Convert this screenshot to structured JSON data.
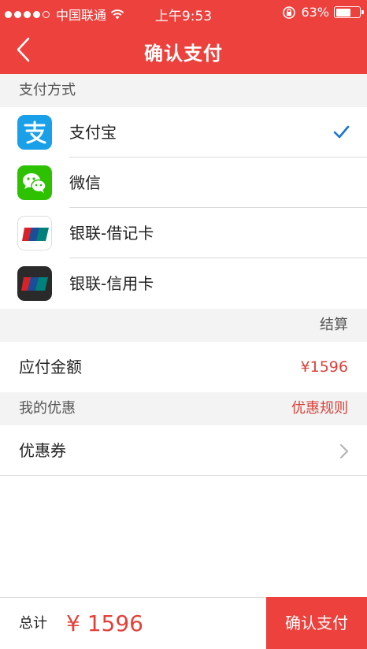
{
  "status_bar": {
    "carrier": "中国联通",
    "time": "上午9:53",
    "battery": "63%",
    "battery_level": 0.63
  },
  "nav": {
    "title": "确认支付"
  },
  "payment": {
    "section_title": "支付方式",
    "methods": [
      {
        "label": "支付宝",
        "icon": "alipay-icon",
        "selected": true
      },
      {
        "label": "微信",
        "icon": "wechat-icon",
        "selected": false
      },
      {
        "label": "银联-借记卡",
        "icon": "unionpay-debit-icon",
        "selected": false
      },
      {
        "label": "银联-信用卡",
        "icon": "unionpay-credit-icon",
        "selected": false
      }
    ]
  },
  "settlement": {
    "section_title": "结算",
    "amount_label": "应付金额",
    "amount_value": "¥1596"
  },
  "discount": {
    "section_title": "我的优惠",
    "rules_link": "优惠规则",
    "coupon_label": "优惠券"
  },
  "footer": {
    "total_label": "总计",
    "total_value": "¥ 1596",
    "confirm_label": "确认支付"
  },
  "colors": {
    "brand_red": "#ec413d",
    "price_red": "#e3403a",
    "check_blue": "#1a73d9",
    "alipay_blue": "#1aa0e8",
    "wechat_green": "#2dc100"
  }
}
